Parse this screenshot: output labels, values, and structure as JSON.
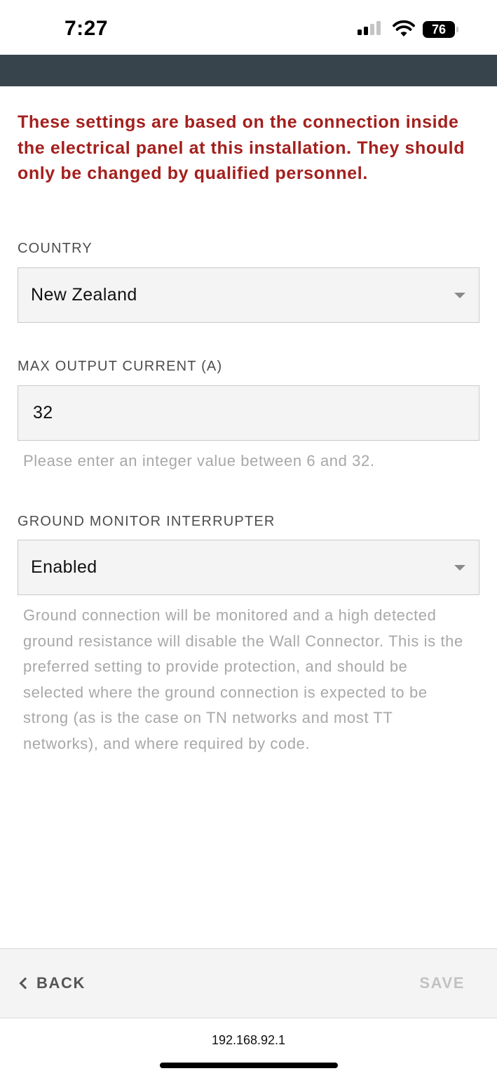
{
  "status_bar": {
    "time": "7:27",
    "battery_level": "76",
    "icons": [
      "signal-icon",
      "wifi-icon",
      "battery-icon"
    ]
  },
  "warning_text": "These settings are based on the connection inside the electrical panel at this installation. They should only be changed by qualified personnel.",
  "country": {
    "label": "COUNTRY",
    "selected": "New Zealand"
  },
  "max_output_current": {
    "label": "MAX OUTPUT CURRENT (A)",
    "value": "32",
    "hint": "Please enter an integer value between 6 and 32."
  },
  "ground_monitor": {
    "label": "GROUND MONITOR INTERRUPTER",
    "selected": "Enabled",
    "description": "Ground connection will be monitored and a high detected ground resistance will disable the Wall Connector. This is the preferred setting to provide protection, and should be selected where the ground connection is expected to be strong (as is the case on TN networks and most TT networks), and where required by code."
  },
  "footer": {
    "back_label": "BACK",
    "save_label": "SAVE"
  },
  "browser": {
    "url": "192.168.92.1"
  },
  "colors": {
    "header": "#37444b",
    "warning": "#a3201d",
    "hint": "#a8a8a8"
  }
}
